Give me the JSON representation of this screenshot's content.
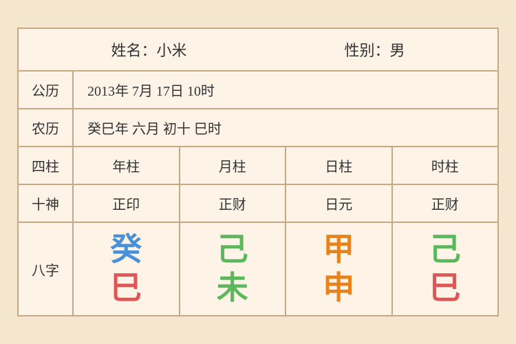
{
  "header": {
    "name_label": "姓名：小米",
    "gender_label": "性别：男"
  },
  "solar": {
    "label": "公历",
    "value": "2013年 7月 17日 10时"
  },
  "lunar": {
    "label": "农历",
    "value": "癸巳年 六月 初十 巳时"
  },
  "columns": {
    "label": "四柱",
    "year": "年柱",
    "month": "月柱",
    "day": "日柱",
    "hour": "时柱"
  },
  "shishen": {
    "label": "十神",
    "year": "正印",
    "month": "正财",
    "day": "日元",
    "hour": "正财"
  },
  "bazi": {
    "label": "八字",
    "year_top": "癸",
    "year_bottom": "巳",
    "month_top": "己",
    "month_bottom": "未",
    "day_top": "甲",
    "day_bottom": "申",
    "hour_top": "己",
    "hour_bottom": "巳"
  }
}
